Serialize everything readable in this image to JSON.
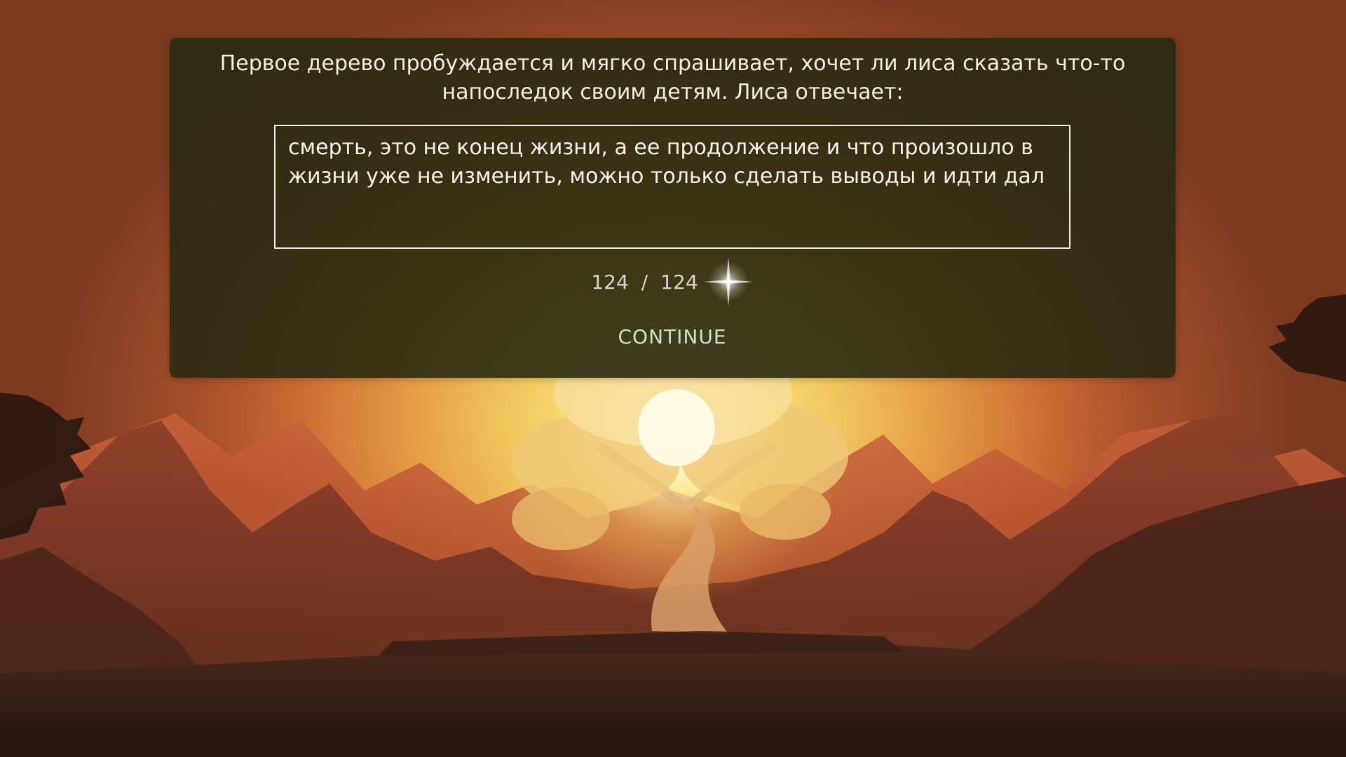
{
  "dialog": {
    "prompt": "Первое дерево пробуждается и мягко спрашивает, хочет ли лиса сказать что-то напоследок своим детям. Лиса отвечает:",
    "answer_text": "смерть, это не конец жизни, а ее продолжение и что произошло в жизни уже не изменить, можно только сделать выводы и идти дал",
    "counter": {
      "current": "124",
      "separator": "/",
      "max": "124",
      "icon": "compass-star-icon"
    },
    "continue_label": "CONTINUE"
  },
  "scene": {
    "description_icons": [
      "tree-icon",
      "sun-icon",
      "mountains-icon"
    ],
    "colors": {
      "sky_glow": "#fff9d8",
      "sky_warm": "#e59b45",
      "ground_dark": "#2a1a12",
      "dialog_bg": "#282a12",
      "continue_text": "#d8dcc6"
    }
  }
}
